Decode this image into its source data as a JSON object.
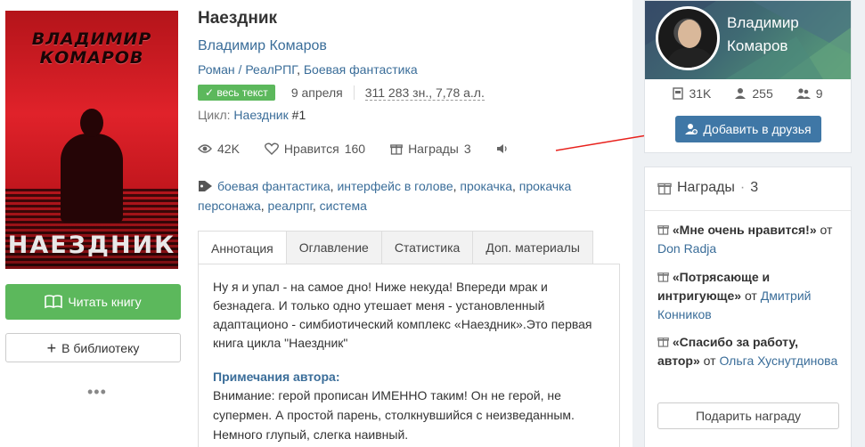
{
  "book": {
    "cover_author_line1": "ВЛАДИМИР",
    "cover_author_line2": "КОМАРОВ",
    "cover_title": "НАЕЗДНИК",
    "title": "Наездник",
    "author": "Владимир Комаров",
    "genre_1": "Роман",
    "genre_sep_1": " / ",
    "genre_2": "РеалРПГ",
    "genre_sep_2": ", ",
    "genre_3": "Боевая фантастика",
    "badge": "весь текст",
    "date": "9 апреля",
    "size": "311 283 зн., 7,78 а.л.",
    "cycle_label": "Цикл:",
    "cycle_name": "Наездник",
    "cycle_num": "#1"
  },
  "counters": {
    "views": "42K",
    "likes_label": "Нравится",
    "likes": "160",
    "awards_label": "Награды",
    "awards": "3"
  },
  "tags": {
    "t1": "боевая фантастика",
    "t2": "интерфейс в голове",
    "t3": "прокачка",
    "t4": "прокачка персонажа",
    "t5": "реалрпг",
    "t6": "система",
    "sep": ", "
  },
  "actions": {
    "read": "Читать книгу",
    "library": "В библиотеку",
    "more": "•••"
  },
  "tabs": [
    "Аннотация",
    "Оглавление",
    "Статистика",
    "Доп. материалы"
  ],
  "annotation": {
    "text": "Ну я и упал - на самое дно! Ниже некуда! Впереди мрак и безнадега. И только одно утешает меня - установленный адаптационо - симбиотический комплекс «Наездник».Это первая книга цикла \"Наездник\"",
    "notes_title": "Примечания автора:",
    "notes": "Внимание: герой прописан ИМЕННО таким! Он не герой, не супермен. А простой парень, столкнувшийся с неизведанным. Немного глупый, слегка наивный."
  },
  "profile": {
    "name": "Владимир Комаров",
    "followers": "31K",
    "friends": "255",
    "mutual": "9",
    "add_friend": "Добавить в друзья"
  },
  "awards": {
    "title": "Награды",
    "dot": "·",
    "count": "3",
    "items": [
      {
        "name": "«Мне очень нравится!»",
        "from": "от",
        "who": "Don Radja"
      },
      {
        "name": "«Потрясающе и интригующе»",
        "from": "от",
        "who": "Дмитрий Конников"
      },
      {
        "name": "«Спасибо за работу, автор»",
        "from": "от",
        "who": "Ольга Хуснутдинова"
      }
    ],
    "gift_button": "Подарить награду"
  }
}
